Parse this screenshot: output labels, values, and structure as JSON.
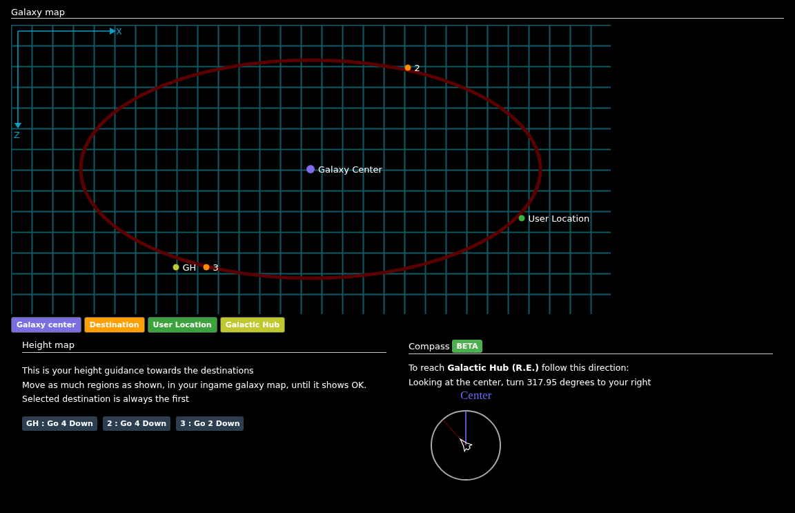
{
  "galaxy_map": {
    "title": "Galaxy map",
    "axes": {
      "x": "X",
      "z": "Z"
    },
    "points": [
      {
        "label": "2",
        "color": "#ff8c00"
      },
      {
        "label": "Galaxy Center",
        "color": "#7b6ee8"
      },
      {
        "label": "User Location",
        "color": "#3cb043"
      },
      {
        "label": "GH",
        "color": "#c0ca33"
      },
      {
        "label": "3",
        "color": "#ff8c00"
      }
    ],
    "legend": [
      {
        "label": "Galaxy center",
        "color": "#7b6ee0"
      },
      {
        "label": "Destination",
        "color": "#ffa000"
      },
      {
        "label": "User Location",
        "color": "#3ca33c"
      },
      {
        "label": "Galactic Hub",
        "color": "#c0c830"
      }
    ]
  },
  "height_map": {
    "title": "Height map",
    "lines": [
      "This is your height guidance towards the destinations",
      "Move as much regions as shown, in your ingame galaxy map, until it shows OK.",
      "Selected destination is always the first"
    ],
    "guidance": [
      "GH : Go 4 Down",
      "2 : Go 4 Down",
      "3 : Go 2 Down"
    ]
  },
  "compass": {
    "title": "Compass",
    "badge": "BETA",
    "instruction": "To reach **Galactic Hub (R.E.)** follow this direction:",
    "detail": "Looking at the center, turn 317.95 degrees to your right",
    "center_label": "Center"
  }
}
